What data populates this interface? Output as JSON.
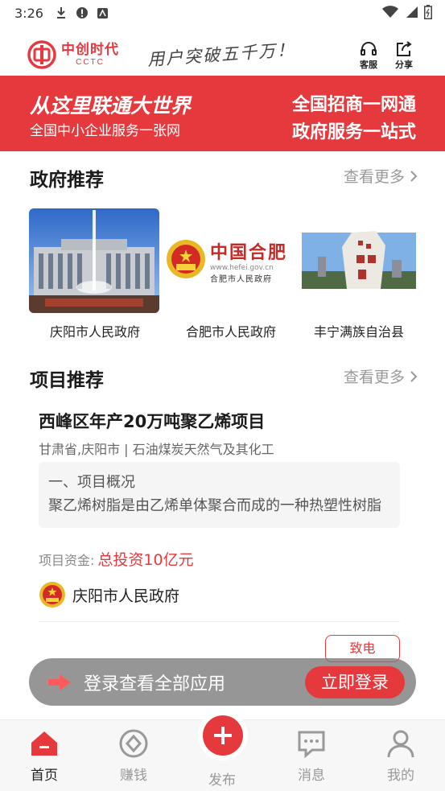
{
  "status_bar": {
    "time": "3:26"
  },
  "header": {
    "logo_cn": "中创时代",
    "logo_en": "CCTC",
    "slogan": "用户突破五千万！",
    "service_label": "客服",
    "share_label": "分享"
  },
  "banner": {
    "headline": "从这里联通大世界",
    "subline": "全国中小企业服务一张网",
    "right_top": "全国招商一网通",
    "right_bottom": "政府服务一站式"
  },
  "gov_section": {
    "title": "政府推荐",
    "more": "查看更多",
    "items": [
      {
        "name": "庆阳市人民政府"
      },
      {
        "name": "合肥市人民政府",
        "logo_title": "中国合肥",
        "logo_url": "www.hefei.gov.cn",
        "logo_sub": "合肥市人民政府"
      },
      {
        "name": "丰宁满族自治县"
      }
    ]
  },
  "project_section": {
    "title": "项目推荐",
    "more": "查看更多",
    "project": {
      "title": "西峰区年产20万吨聚乙烯项目",
      "location": "甘肃省,庆阳市 | 石油煤炭天然气及其化工",
      "summary_heading": "一、项目概况",
      "summary_text": "聚乙烯树脂是由乙烯单体聚合而成的一种热塑性树脂",
      "fund_label": "项目资金:",
      "fund_value": "总投资10亿元",
      "owner": "庆阳市人民政府",
      "call_label": "致电"
    }
  },
  "login_bar": {
    "text": "登录查看全部应用",
    "button": "立即登录"
  },
  "bottom_nav": {
    "items": [
      {
        "label": "首页",
        "icon": "home-icon"
      },
      {
        "label": "赚钱",
        "icon": "money-icon"
      },
      {
        "label": "发布",
        "icon": "plus-icon"
      },
      {
        "label": "消息",
        "icon": "message-icon"
      },
      {
        "label": "我的",
        "icon": "user-icon"
      }
    ]
  },
  "colors": {
    "accent": "#e5393e",
    "muted": "#999999"
  }
}
